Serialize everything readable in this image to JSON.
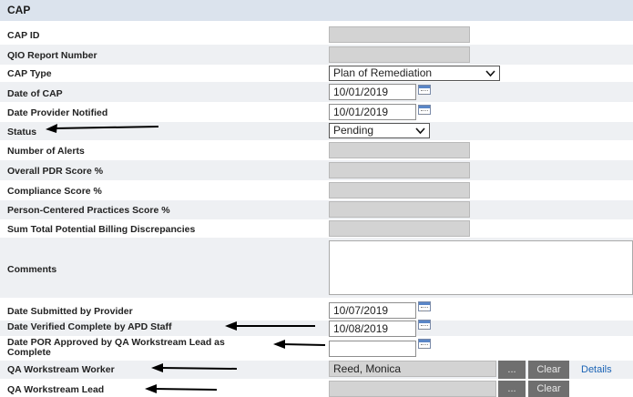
{
  "section_title": "CAP",
  "labels": {
    "cap_id": "CAP ID",
    "qio": "QIO Report Number",
    "cap_type": "CAP Type",
    "date_of_cap": "Date of CAP",
    "date_notified": "Date Provider Notified",
    "status": "Status",
    "alerts": "Number of Alerts",
    "pdr": "Overall PDR Score %",
    "compliance": "Compliance Score %",
    "person_centered": "Person-Centered Practices Score %",
    "billing": "Sum Total Potential Billing Discrepancies",
    "comments": "Comments",
    "date_submitted": "Date Submitted by Provider",
    "date_verified": "Date Verified Complete by APD Staff",
    "date_por_1": "Date POR Approved by QA Workstream Lead as",
    "date_por_2": "Complete",
    "worker": "QA Workstream Worker",
    "lead": "QA Workstream Lead"
  },
  "values": {
    "cap_type": "Plan of Remediation",
    "date_of_cap": "10/01/2019",
    "date_notified": "10/01/2019",
    "status": "Pending",
    "date_submitted": "10/07/2019",
    "date_verified": "10/08/2019",
    "date_por": "",
    "worker": "Reed, Monica",
    "lead": ""
  },
  "buttons": {
    "ellipsis": "...",
    "clear": "Clear",
    "details": "Details"
  }
}
